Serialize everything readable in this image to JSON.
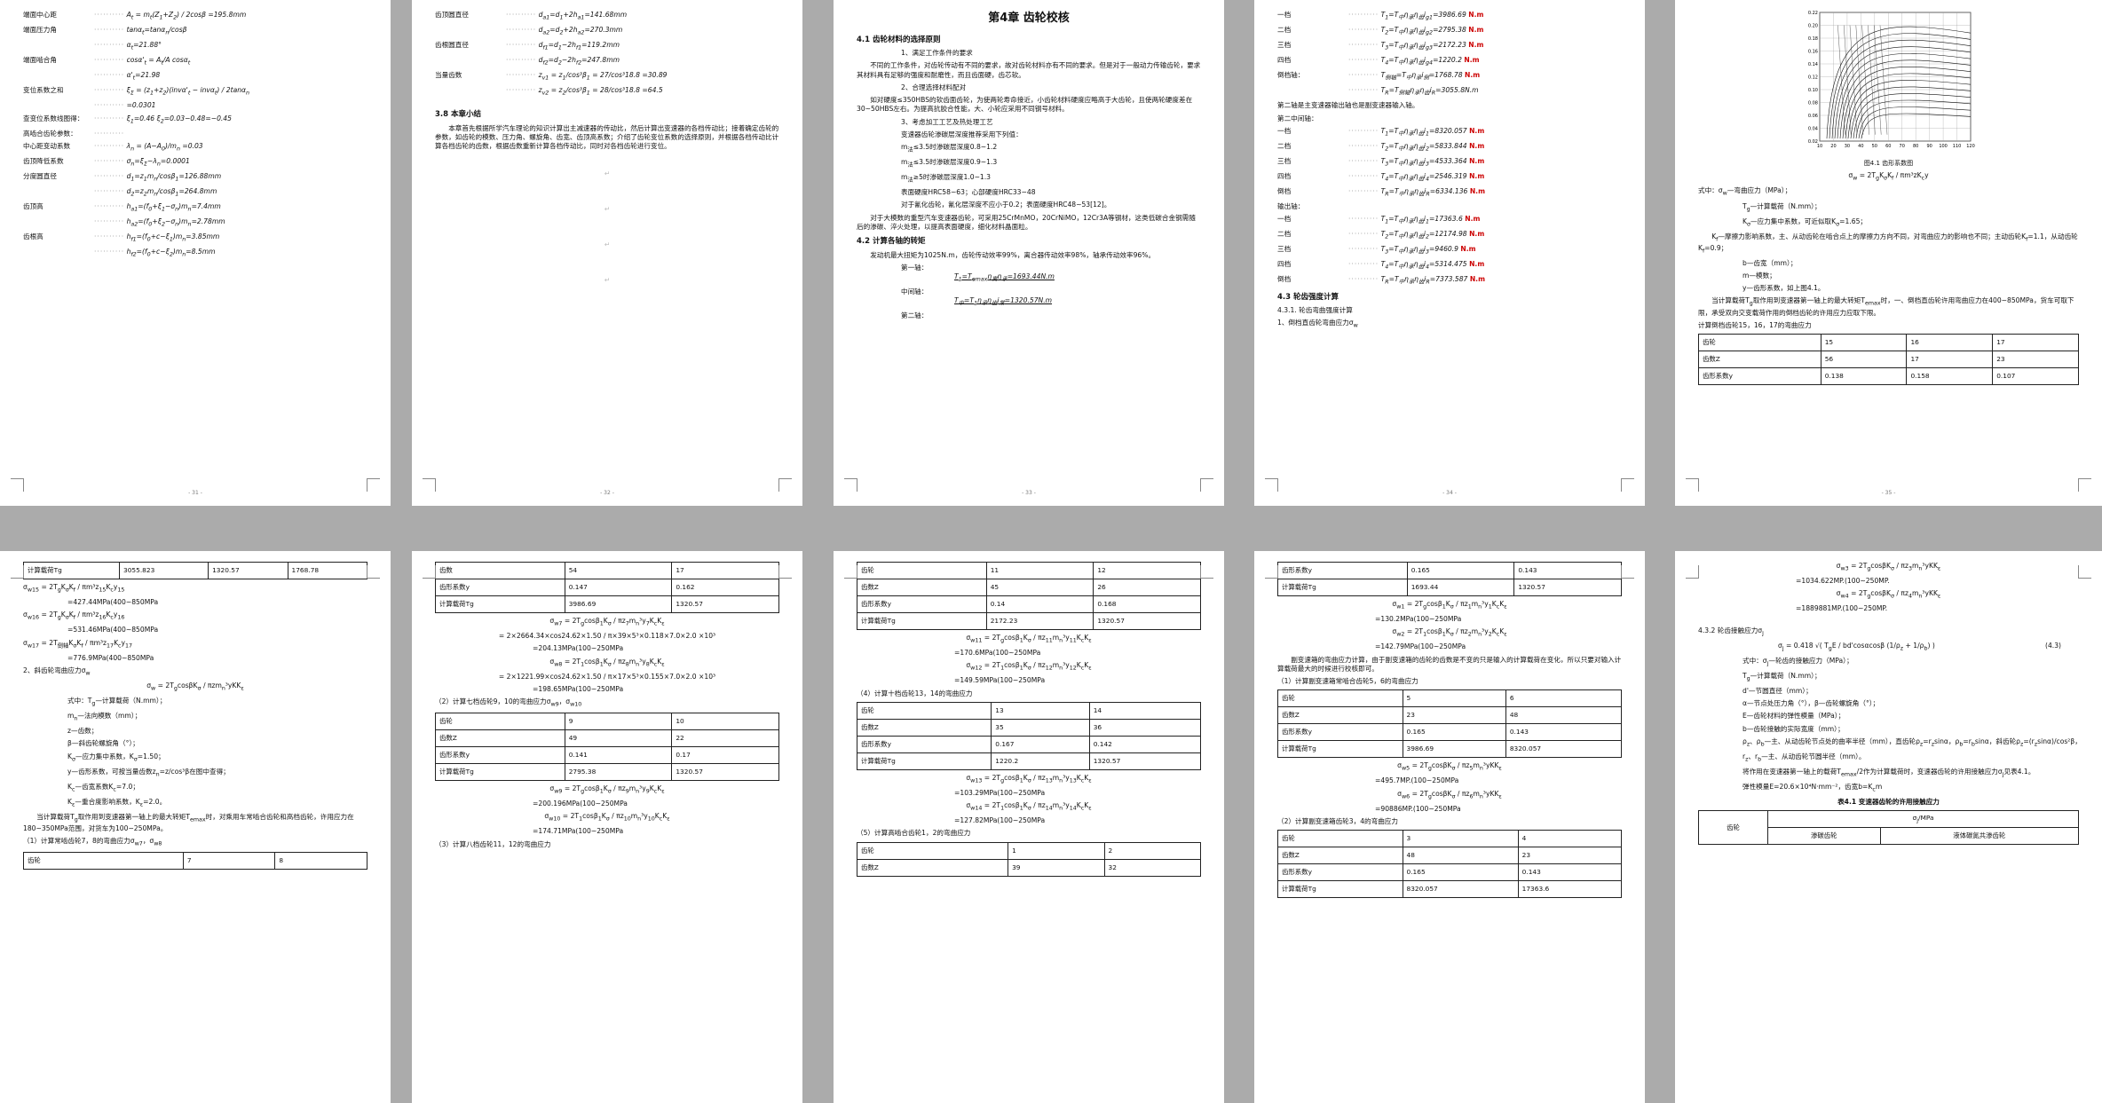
{
  "pages": [
    {
      "id": "p1",
      "lines": [
        {
          "t": "端面中心距",
          "f": "A<sub>t</sub> = m<sub>t</sub>(Z<sub>1</sub>+Z<sub>2</sub>) / 2cosβ =195.8mm"
        },
        {
          "t": "端面压力角",
          "f": "tanα<sub>t</sub>=tanα<sub>n</sub>/cosβ"
        },
        {
          "t": "",
          "f": "α<sub>t</sub>=21.88°"
        },
        {
          "t": "端面啮合角",
          "f": "cosα'<sub>t</sub> = A<sub>t</sub>/A cosα<sub>t</sub>"
        },
        {
          "t": "",
          "f": "α'<sub>t</sub>=21.98"
        },
        {
          "t": "变位系数之和",
          "f": "ξ<sub>Σ</sub> = (z<sub>1</sub>+z<sub>2</sub>)(invα'<sub>t</sub> − invα<sub>t</sub>) / 2tanα<sub>n</sub>"
        },
        {
          "t": "",
          "f": "=0.0301"
        },
        {
          "t": "查变位系数线图得：",
          "f": "ξ<sub>1</sub>=0.46 ξ<sub>2</sub>=0.03−0.48=−0.45"
        },
        {
          "t": "高啮合齿轮参数：",
          "f": ""
        },
        {
          "t": "中心距变动系数",
          "f": "λ<sub>n</sub> = (A−A<sub>0</sub>)/m<sub>n</sub> =0.03"
        },
        {
          "t": "齿顶降低系数",
          "f": "σ<sub>n</sub>=ξ<sub>Σ</sub>−λ<sub>n</sub>=0.0001"
        },
        {
          "t": "分度圆直径",
          "f": "d<sub>1</sub>=z<sub>1</sub>m<sub>n</sub>/cosβ<sub>1</sub>=126.88mm"
        },
        {
          "t": "",
          "f": "d<sub>2</sub>=z<sub>2</sub>m<sub>n</sub>/cosβ<sub>1</sub>=264.8mm"
        },
        {
          "t": "齿顶高",
          "f": "h<sub>a1</sub>=(f<sub>0</sub>+ξ<sub>1</sub>−σ<sub>n</sub>)m<sub>n</sub>=7.4mm"
        },
        {
          "t": "",
          "f": "h<sub>a2</sub>=(f<sub>0</sub>+ξ<sub>2</sub>−σ<sub>n</sub>)m<sub>n</sub>=2.78mm"
        },
        {
          "t": "齿根高",
          "f": "h<sub>f1</sub>=(f<sub>0</sub>+c−ξ<sub>1</sub>)m<sub>n</sub>=3.85mm"
        },
        {
          "t": "",
          "f": "h<sub>f2</sub>=(f<sub>0</sub>+c−ξ<sub>2</sub>)m<sub>n</sub>=8.5mm"
        }
      ],
      "page_no": "- 31 -"
    }
  ],
  "p2": {
    "lines": [
      {
        "t": "齿顶圆直径",
        "f": "d<sub>a1</sub>=d<sub>1</sub>+2h<sub>a1</sub>=141.68mm"
      },
      {
        "t": "",
        "f": "d<sub>a2</sub>=d<sub>2</sub>+2h<sub>a2</sub>=270.3mm"
      },
      {
        "t": "齿根圆直径",
        "f": "d<sub>f1</sub>=d<sub>1</sub>−2h<sub>f1</sub>=119.2mm"
      },
      {
        "t": "",
        "f": "d<sub>f2</sub>=d<sub>2</sub>−2h<sub>f2</sub>=247.8mm"
      },
      {
        "t": "当量齿数",
        "f": "z<sub>v1</sub> = z<sub>1</sub>/cos³β<sub>1</sub> = 27/cos³18.8 =30.89"
      },
      {
        "t": "",
        "f": "z<sub>v2</sub> = z<sub>2</sub>/cos³β<sub>1</sub> = 28/cos³18.8 =64.5"
      }
    ],
    "section": "3.8 本章小结",
    "summary": "本章首先根据所学汽车理论的知识计算出主减速器的传动比，然后计算出变速器的各档传动比；接着确定齿轮的参数，如齿轮的模数、压力角、螺旋角、齿宽、齿顶高系数；介绍了齿轮变位系数的选择原则，并根据各档传动比计算各档齿轮的齿数，根据齿数重新计算各档传动比，同时对各档齿轮进行变位。",
    "page_no": "- 32 -"
  },
  "p3": {
    "title": "第4章 齿轮校核",
    "s41": "4.1 齿轮材料的选择原则",
    "items": [
      "1、满足工作条件的要求",
      "不同的工作条件，对齿轮传动有不同的要求，故对齿轮材料亦有不同的要求。但是对于一般动力传输齿轮，要求其材料具有足够的强度和耐磨性，而且齿面硬，齿芯软。",
      "2、合理选择材料配对",
      "如对硬度≤350HBS的软齿面齿轮，为使两轮寿命接近，小齿轮材料硬度应略高于大齿轮，且使两轮硬度差在30~50HBS左右。为提高抗胶合性能，大、小轮应采用不同钢号材料。",
      "3、考虑加工工艺及热处理工艺",
      "变速器齿轮渗碳层深度推荐采用下列值：",
      "m<sub>法</sub>≤3.5时渗碳层深度0.8~1.2",
      "m<sub>法</sub>≤3.5时渗碳层深度0.9~1.3",
      "m<sub>法</sub>≥5时渗碳层深度1.0~1.3",
      "表面硬度HRC58~63；心部硬度HRC33~48",
      "对于氰化齿轮，氰化层深度不应小于0.2；表面硬度HRC48~53[12]。",
      "对于大模数的重型汽车变速器齿轮，可采用25CrMnMO，20CrNiMO，12Cr3A等钢材，这类低碳合金钢需随后的渗碳、淬火处理，以提高表面硬度，细化材料晶面粒。"
    ],
    "s42": "4.2 计算各轴的转矩",
    "s42text": "发动机最大扭矩为1025N.m，齿轮传动效率99%，离合器传动效率98%，轴承传动效率96%。",
    "shafts": [
      {
        "label": "第一轴：",
        "f": "T<sub>1</sub>=T<sub>emax</sub>η<sub>离</sub>η<sub>承</sub>=1693.44N.m"
      },
      {
        "label": "中间轴：",
        "f": "T<sub>中</sub>=T<sub>1</sub>η<sub>承</sub>η<sub>齿</sub>i<sub>常</sub>=1320.57N.m"
      },
      {
        "label": "第二轴：",
        "f": ""
      }
    ],
    "page_no": "- 33 -"
  },
  "p4": {
    "top": [
      {
        "t": "一档",
        "f": "T<sub>1</sub>=T<sub>中</sub>η<sub>承</sub>η<sub>齿</sub>i<sub>g1</sub>=3986.69",
        "m": "N.m"
      },
      {
        "t": "二档",
        "f": "T<sub>2</sub>=T<sub>中</sub>η<sub>承</sub>η<sub>齿</sub>i<sub>g2</sub>=2795.38",
        "m": "N.m"
      },
      {
        "t": "三档",
        "f": "T<sub>3</sub>=T<sub>中</sub>η<sub>承</sub>η<sub>齿</sub>i<sub>g3</sub>=2172.23",
        "m": "N.m"
      },
      {
        "t": "四档",
        "f": "T<sub>4</sub>=T<sub>中</sub>η<sub>承</sub>η<sub>齿</sub>i<sub>g4</sub>=1220.2",
        "m": "N.m"
      },
      {
        "t": "倒档轴：",
        "f": "T<sub>倒轴</sub>=T<sub>中</sub>η<sub>承</sub>i<sub>倒</sub>=1768.78",
        "m": "N.m"
      },
      {
        "t": "",
        "f": "T<sub>R</sub>=T<sub>倒轴</sub>η<sub>承</sub>η<sub>齿</sub>i<sub>R</sub>=3055.8N.m"
      }
    ],
    "note": "第二轴是主变速器输出轴也是副变速器输入轴。",
    "second": "第二中间轴：",
    "mid": [
      {
        "t": "一档",
        "f": "T<sub>1</sub>=T<sub>中</sub>η<sub>承</sub>η<sub>齿</sub>i<sub>1</sub>=8320.057",
        "m": "N.m"
      },
      {
        "t": "二档",
        "f": "T<sub>2</sub>=T<sub>中</sub>η<sub>承</sub>η<sub>齿</sub>i<sub>2</sub>=5833.844",
        "m": "N.m"
      },
      {
        "t": "三档",
        "f": "T<sub>3</sub>=T<sub>中</sub>η<sub>承</sub>η<sub>齿</sub>i<sub>3</sub>=4533.364",
        "m": "N.m"
      },
      {
        "t": "四档",
        "f": "T<sub>4</sub>=T<sub>中</sub>η<sub>承</sub>η<sub>齿</sub>i<sub>4</sub>=2546.319",
        "m": "N.m"
      },
      {
        "t": "倒档",
        "f": "T<sub>R</sub>=T<sub>中</sub>η<sub>承</sub>η<sub>齿</sub>i<sub>R</sub>=6334.136",
        "m": "N.m"
      }
    ],
    "out": "输出轴：",
    "outs": [
      {
        "t": "一档",
        "f": "T<sub>1</sub>=T<sub>中</sub>η<sub>承</sub>η<sub>齿</sub>i<sub>1</sub>=17363.6",
        "m": "N.m"
      },
      {
        "t": "二档",
        "f": "T<sub>2</sub>=T<sub>中</sub>η<sub>承</sub>η<sub>齿</sub>i<sub>2</sub>=12174.98",
        "m": "N.m"
      },
      {
        "t": "三档",
        "f": "T<sub>3</sub>=T<sub>中</sub>η<sub>承</sub>η<sub>齿</sub>i<sub>3</sub>=9460.9",
        "m": "N.m"
      },
      {
        "t": "四档",
        "f": "T<sub>4</sub>=T<sub>中</sub>η<sub>承</sub>η<sub>齿</sub>i<sub>4</sub>=5314.475",
        "m": "N.m"
      },
      {
        "t": "倒档",
        "f": "T<sub>R</sub>=T<sub>中</sub>η<sub>承</sub>η<sub>齿</sub>i<sub>R</sub>=7373.587",
        "m": "N.m"
      }
    ],
    "s43": "4.3 轮齿强度计算",
    "s431": "4.3.1. 轮齿弯曲强度计算",
    "s431a": "1、倒档直齿轮弯曲应力σ<sub>w</sub>",
    "page_no": "- 34 -"
  },
  "p5": {
    "fig_caption": "图4.1 齿形系数图",
    "formula": "σ<sub>w</sub> = 2T<sub>g</sub>K<sub>σ</sub>K<sub>f</sub> / πm³zK<sub>c</sub>y",
    "defs": [
      "式中：σ<sub>w</sub>—弯曲应力（MPa）；",
      "T<sub>g</sub>—计算载荷（N.mm）；",
      "K<sub>σ</sub>—应力集中系数，可近似取K<sub>σ</sub>=1.65；",
      "K<sub>f</sub>—摩擦力影响系数，主、从动齿轮在啮合点上的摩擦力方向不同，对弯曲应力的影响也不同；主动齿轮K<sub>f</sub>=1.1，从动齿轮K<sub>f</sub>=0.9；",
      "b—齿宽（mm）；",
      "m—模数；",
      "y—齿形系数，如上图4.1。",
      "当计算载荷T<sub>g</sub>取作用到变速器第一轴上的最大转矩T<sub>emax</sub>时，一、倒档直齿轮许用弯曲应力在400~850MPa，货车可取下限，承受双向交变载荷作用的倒档齿轮的许用应力应取下限。",
      "计算倒档齿轮15，16，17的弯曲应力"
    ],
    "table": [
      [
        "齿轮",
        "15",
        "16",
        "17"
      ],
      [
        "齿数Z",
        "56",
        "17",
        "23"
      ],
      [
        "齿形系数y",
        "0.138",
        "0.158",
        "0.107"
      ]
    ],
    "page_no": "- 35 -"
  },
  "p6": {
    "table_top": [
      [
        "计算载荷Tg",
        "3055.823",
        "1320.57",
        "1768.78"
      ]
    ],
    "lines": [
      "σ<sub>w15</sub> = 2T<sub>g</sub>K<sub>σ</sub>K<sub>f</sub> / πm³z<sub>15</sub>K<sub>c</sub>y<sub>15</sub>",
      "=427.44MPa(400~850MPa",
      "σ<sub>w16</sub> = 2T<sub>g</sub>K<sub>σ</sub>K<sub>f</sub> / πm³z<sub>16</sub>K<sub>c</sub>y<sub>16</sub>",
      "=531.46MPa(400~850MPa",
      "σ<sub>w17</sub> = 2T<sub>倒轴</sub>K<sub>σ</sub>K<sub>f</sub> / πm³z<sub>17</sub>K<sub>c</sub>y<sub>17</sub>",
      "=776.9MPa(400~850MPa"
    ],
    "s2": "2、斜齿轮弯曲应力σ<sub>w</sub>",
    "formula": "σ<sub>w</sub> = 2T<sub>g</sub>cosβK<sub>σ</sub> / πzm<sub>n</sub>³yKK<sub>ε</sub>",
    "defs": [
      "式中：T<sub>g</sub>—计算载荷（N.mm）；",
      "m<sub>n</sub>—法向模数（mm）；",
      "z—齿数；",
      "β—斜齿轮螺旋角（°）；",
      "K<sub>σ</sub>—应力集中系数，K<sub>σ</sub>=1.50；",
      "y—齿形系数，可按当量齿数z<sub>n</sub>=z/cos³β在图中查得；",
      "K<sub>c</sub>—齿宽系数K<sub>c</sub>=7.0；",
      "K<sub>ε</sub>—重合度影响系数，K<sub>ε</sub>=2.0。"
    ],
    "para": "当计算载荷T<sub>g</sub>取作用到变速器第一轴上的最大转矩T<sub>emax</sub>时，对乘用车常啮合齿轮和高档齿轮，许用应力在180~350MPa范围，对货车为100~250MPa。",
    "s1": "（1）计算常啮齿轮7，8的弯曲应力σ<sub>w7</sub>，σ<sub>w8</sub>",
    "table_bottom": [
      [
        "齿轮",
        "7",
        "8"
      ]
    ],
    "page_no": ""
  },
  "p7": {
    "table1": [
      [
        "齿数",
        "54",
        "17"
      ],
      [
        "齿形系数y",
        "0.147",
        "0.162"
      ],
      [
        "计算载荷Tg",
        "3986.69",
        "1320.57"
      ]
    ],
    "f1": "σ<sub>w7</sub> = 2T<sub>g</sub>cosβ<sub>1</sub>K<sub>σ</sub> / πz<sub>7</sub>m<sub>n</sub>³y<sub>7</sub>K<sub>c</sub>K<sub>ε</sub>",
    "v1": "= 2×2664.34×cos24.62×1.50 / π×39×5³×0.118×7.0×2.0 ×10³",
    "r1": "=204.13MPa(100~250MPa",
    "f2": "σ<sub>w8</sub> = 2T<sub>1</sub>cosβ<sub>1</sub>K<sub>σ</sub> / πz<sub>8</sub>m<sub>n</sub>³y<sub>8</sub>K<sub>c</sub>K<sub>ε</sub>",
    "v2": "= 2×1221.99×cos24.62×1.50 / π×17×5³×0.155×7.0×2.0 ×10³",
    "r2": "=198.65MPa(100~250MPa",
    "s2": "（2）计算七档齿轮9，10的弯曲应力σ<sub>w9</sub>，σ<sub>w10</sub>",
    "table2": [
      [
        "齿轮",
        "9",
        "10"
      ],
      [
        "齿数Z",
        "49",
        "22"
      ],
      [
        "齿形系数y",
        "0.141",
        "0.17"
      ],
      [
        "计算载荷Tg",
        "2795.38",
        "1320.57"
      ]
    ],
    "f3": "σ<sub>w9</sub> = 2T<sub>g</sub>cosβ<sub>1</sub>K<sub>σ</sub> / πz<sub>9</sub>m<sub>n</sub>³y<sub>9</sub>K<sub>c</sub>K<sub>ε</sub>",
    "r3": "=200.196MPa(100~250MPa",
    "f4": "σ<sub>w10</sub> = 2T<sub>1</sub>cosβ<sub>1</sub>K<sub>σ</sub> / πz<sub>10</sub>m<sub>n</sub>³y<sub>10</sub>K<sub>c</sub>K<sub>ε</sub>",
    "r4": "=174.71MPa(100~250MPa",
    "s3": "（3）计算八档齿轮11，12的弯曲应力",
    "page_no": ""
  },
  "p8": {
    "table1": [
      [
        "齿轮",
        "11",
        "12"
      ],
      [
        "齿数Z",
        "45",
        "26"
      ],
      [
        "齿形系数y",
        "0.14",
        "0.168"
      ],
      [
        "计算载荷Tg",
        "2172.23",
        "1320.57"
      ]
    ],
    "f1": "σ<sub>w11</sub> = 2T<sub>g</sub>cosβ<sub>1</sub>K<sub>σ</sub> / πz<sub>11</sub>m<sub>n</sub>³y<sub>11</sub>K<sub>c</sub>K<sub>ε</sub>",
    "r1": "=170.6MPa(100~250MPa",
    "f2": "σ<sub>w12</sub> = 2T<sub>1</sub>cosβ<sub>1</sub>K<sub>σ</sub> / πz<sub>12</sub>m<sub>n</sub>³y<sub>12</sub>K<sub>c</sub>K<sub>ε</sub>",
    "r2": "=149.59MPa(100~250MPa",
    "s2": "（4）计算十档齿轮13，14的弯曲应力",
    "table2": [
      [
        "齿轮",
        "13",
        "14"
      ],
      [
        "齿数Z",
        "35",
        "36"
      ],
      [
        "齿形系数y",
        "0.167",
        "0.142"
      ],
      [
        "计算载荷Tg",
        "1220.2",
        "1320.57"
      ]
    ],
    "f3": "σ<sub>w13</sub> = 2T<sub>g</sub>cosβ<sub>1</sub>K<sub>σ</sub> / πz<sub>13</sub>m<sub>n</sub>³y<sub>13</sub>K<sub>c</sub>K<sub>ε</sub>",
    "r3": "=103.29MPa(100~250MPa",
    "f4": "σ<sub>w14</sub> = 2T<sub>1</sub>cosβ<sub>1</sub>K<sub>σ</sub> / πz<sub>14</sub>m<sub>n</sub>³y<sub>14</sub>K<sub>c</sub>K<sub>ε</sub>",
    "r4": "=127.82MPa(100~250MPa",
    "s3": "（5）计算高啮合齿轮1，2的弯曲应力",
    "table3": [
      [
        "齿轮",
        "1",
        "2"
      ],
      [
        "齿数Z",
        "39",
        "32"
      ]
    ],
    "page_no": ""
  },
  "p9": {
    "table1": [
      [
        "齿形系数y",
        "0.165",
        "0.143"
      ],
      [
        "计算载荷Tg",
        "1693.44",
        "1320.57"
      ]
    ],
    "f1": "σ<sub>w1</sub> = 2T<sub>g</sub>cosβ<sub>1</sub>K<sub>σ</sub> / πz<sub>1</sub>m<sub>n</sub>³y<sub>1</sub>K<sub>c</sub>K<sub>ε</sub>",
    "r1": "=130.2MPa(100~250MPa",
    "f2": "σ<sub>w2</sub> = 2T<sub>1</sub>cosβ<sub>1</sub>K<sub>σ</sub> / πz<sub>2</sub>m<sub>n</sub>³y<sub>2</sub>K<sub>c</sub>K<sub>ε</sub>",
    "r2": "=142.79MPa(100~250MPa",
    "para": "副变速箱的弯曲应力计算，由于副变速箱的齿轮的齿数是不变的只是输入的计算载荷在变化，所以只要对输入计算载荷最大的时候进行校核即可。",
    "s1": "（1）计算副变速箱常啮合齿轮5，6的弯曲应力",
    "table2": [
      [
        "齿轮",
        "5",
        "6"
      ],
      [
        "齿数Z",
        "23",
        "48"
      ],
      [
        "齿形系数y",
        "0.165",
        "0.143"
      ],
      [
        "计算载荷Tg",
        "3986.69",
        "8320.057"
      ]
    ],
    "f3": "σ<sub>w5</sub> = 2T<sub>g</sub>cosβK<sub>σ</sub> / πz<sub>5</sub>m<sub>n</sub>³yKK<sub>ε</sub>",
    "r3": "=495.7MP.(100~250MPa",
    "f4": "σ<sub>w6</sub> = 2T<sub>g</sub>cosβK<sub>σ</sub> / πz<sub>6</sub>m<sub>n</sub>³yKK<sub>ε</sub>",
    "r4": "=90886MP.(100~250MPa",
    "s2": "（2）计算副变速箱齿轮3，4的弯曲应力",
    "table3": [
      [
        "齿轮",
        "3",
        "4"
      ],
      [
        "齿数Z",
        "48",
        "23"
      ],
      [
        "齿形系数y",
        "0.165",
        "0.143"
      ],
      [
        "计算载荷Tg",
        "8320.057",
        "17363.6"
      ]
    ],
    "page_no": ""
  },
  "p10": {
    "f1": "σ<sub>w3</sub> = 2T<sub>g</sub>cosβK<sub>σ</sub> / πz<sub>3</sub>m<sub>n</sub>³yKK<sub>ε</sub>",
    "r1": "=1034.622MP.(100~250MP.",
    "f2": "σ<sub>w4</sub> = 2T<sub>g</sub>cosβK<sub>σ</sub> / πz<sub>4</sub>m<sub>n</sub>³yKK<sub>ε</sub>",
    "r2": "=1889881MP.(100~250MP.",
    "s432": "4.3.2 轮齿接触应力σ<sub>j</sub>",
    "fmain": "σ<sub>j</sub> = 0.418 √( T<sub>g</sub>E / bd'cosαcosβ (1/ρ<sub>z</sub> + 1/ρ<sub>b</sub>) )",
    "eqno": "(4.3)",
    "defs": [
      "式中：σ<sub>j</sub>—轮齿的接触应力（MPa）；",
      "T<sub>g</sub>—计算载荷（N.mm）；",
      "d'—节圆直径（mm）；",
      "α—节点处压力角（°），β—齿轮螺旋角（°）；",
      "E—齿轮材料的弹性模量（MPa）；",
      "b—齿轮接触的实际宽度（mm）；",
      "ρ<sub>z</sub>、ρ<sub>b</sub>—主、从动齿轮节点处的曲率半径（mm），直齿轮ρ<sub>z</sub>=r<sub>z</sub>sinα，ρ<sub>b</sub>=r<sub>b</sub>sinα，斜齿轮ρ<sub>z</sub>=(r<sub>z</sub>sinα)/cos²β，ρ<sub>b</sub>=(r<sub>b</sub>sinα)/cos²β；",
      "r<sub>z</sub>、r<sub>b</sub>—主、从动齿轮节圆半径（mm）。",
      "将作用在变速器第一轴上的载荷T<sub>emax</sub>/2作为计算载荷时，变速器齿轮的许用接触应力σ<sub>j</sub>见表4.1。",
      "弹性模量E=20.6×10⁴N·mm⁻²，齿宽b=K<sub>c</sub>m"
    ],
    "tcap": "表4.1 变速器齿轮的许用接触应力",
    "thead": [
      "齿轮",
      "σ<sub>j</sub>/MPa",
      "渗碳齿轮",
      "液体碳氮共渗齿轮"
    ],
    "page_no": ""
  },
  "chart": {
    "y_ticks": [
      "0.22",
      "0.20",
      "0.18",
      "0.16",
      "0.14",
      "0.12",
      "0.10",
      "0.08",
      "0.06",
      "0.04",
      "0.02"
    ],
    "x_ticks": [
      "10",
      "20",
      "30",
      "40",
      "50",
      "60",
      "70",
      "80",
      "90",
      "100",
      "110",
      "120"
    ]
  }
}
